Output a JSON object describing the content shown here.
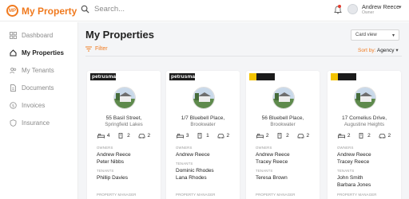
{
  "header": {
    "logo_initials": "MP",
    "app_title": "My Property",
    "search_placeholder": "Search...",
    "user_name": "Andrew Reece",
    "user_role": "Owner"
  },
  "sidebar": {
    "items": [
      {
        "label": "Dashboard",
        "icon": "grid-icon"
      },
      {
        "label": "My Properties",
        "icon": "home-icon",
        "active": true
      },
      {
        "label": "My Tenants",
        "icon": "people-icon"
      },
      {
        "label": "Documents",
        "icon": "document-icon"
      },
      {
        "label": "Invoices",
        "icon": "invoice-icon"
      },
      {
        "label": "Insurance",
        "icon": "shield-icon"
      }
    ]
  },
  "main": {
    "title": "My Properties",
    "view_select": "Card view",
    "filter_label": "Filter",
    "sort_label": "Sort by:",
    "sort_value": "Agency"
  },
  "labels": {
    "owners": "OWNERS",
    "tenants": "TENANTS",
    "property_manager": "PROPERTY MANAGER"
  },
  "properties": [
    {
      "brand": "petrusma",
      "brand_style": "dark",
      "address": "55 Basil Street,",
      "suburb": "Springfield Lakes",
      "beds": "4",
      "baths": "2",
      "cars": "2",
      "owners": [
        "Andrew Reece",
        "Peter Nibbs"
      ],
      "tenants": [
        "Phillip Davies"
      ]
    },
    {
      "brand": "petrusma",
      "brand_style": "dark",
      "address": "1/7 Bluebell Place,",
      "suburb": "Brookwater",
      "beds": "3",
      "baths": "1",
      "cars": "2",
      "owners": [
        "Andrew Reece"
      ],
      "tenants": [
        "Dominic Rhodes",
        "Lana Rhodes"
      ]
    },
    {
      "brand": "",
      "brand_style": "gold",
      "address": "56 Bluebell Place,",
      "suburb": "Brookwater",
      "beds": "2",
      "baths": "2",
      "cars": "2",
      "owners": [
        "Andrew Reece",
        "Tracey Reece"
      ],
      "tenants": [
        "Teresa Brown"
      ]
    },
    {
      "brand": "",
      "brand_style": "gold",
      "address": "17 Cornelius Drive,",
      "suburb": "Augustine Heights",
      "beds": "2",
      "baths": "2",
      "cars": "2",
      "owners": [
        "Andrew Reece",
        "Tracey Reece"
      ],
      "tenants": [
        "John Smith",
        "Barbara Jones"
      ]
    }
  ],
  "colors": {
    "accent": "#f07a1f",
    "background": "#f4f5f7"
  }
}
